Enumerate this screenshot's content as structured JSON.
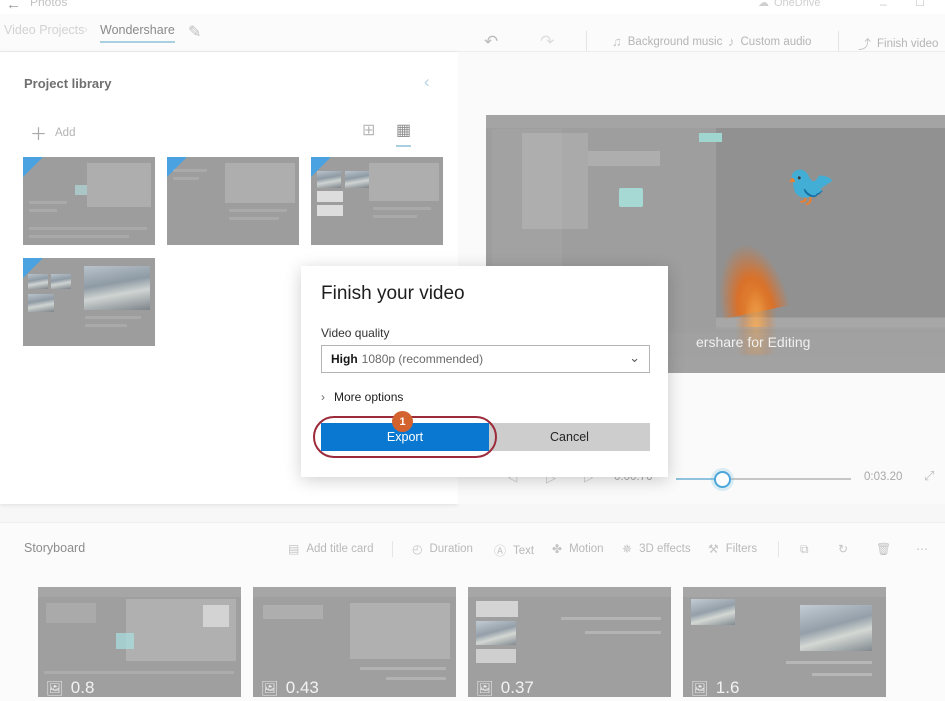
{
  "titlebar": {
    "back_icon": "back-arrow-icon",
    "app_name": "Photos",
    "onedrive_label": "OneDrive",
    "onedrive_icon": "cloud-icon",
    "minimize_glyph": "–",
    "maximize_glyph": "☐"
  },
  "breadcrumb": {
    "parent": "Video Projects",
    "separator": "›",
    "current": "Wondershare",
    "edit_icon": "pencil-icon"
  },
  "toolbar": {
    "undo_icon": "undo-arrow-icon",
    "undo_glyph": "↶",
    "redo_icon": "redo-arrow-icon",
    "redo_glyph": "↷",
    "background_music": "Background music",
    "background_music_icon": "music-note-icon",
    "background_music_glyph": "♫",
    "custom_audio": "Custom audio",
    "custom_audio_icon": "person-audio-icon",
    "custom_audio_glyph": "♪",
    "finish_video": "Finish video",
    "finish_video_icon": "share-export-icon",
    "finish_video_glyph": "⤴"
  },
  "library": {
    "title": "Project library",
    "collapse_icon": "chevron-left-icon",
    "collapse_glyph": "‹",
    "add_label": "Add",
    "add_glyph": "＋",
    "view_list_icon": "grid-view-small-icon",
    "view_list_glyph": "⊞",
    "view_grid_icon": "grid-view-large-icon",
    "view_grid_glyph": "▦",
    "items": [
      {
        "name": "library-thumbnail-1"
      },
      {
        "name": "library-thumbnail-2"
      },
      {
        "name": "library-thumbnail-3"
      },
      {
        "name": "library-thumbnail-4"
      }
    ]
  },
  "preview": {
    "caption": "ershare for Editing",
    "playback": {
      "previous_icon": "previous-frame-icon",
      "previous_glyph": "◁",
      "play_icon": "play-icon",
      "play_glyph": "▷",
      "next_icon": "next-frame-icon",
      "next_glyph": "▷",
      "current_time": "0:00.76",
      "total_time": "0:03.20",
      "fullscreen_icon": "expand-diagonal-icon",
      "fullscreen_glyph": "⤢"
    }
  },
  "storyboard": {
    "title": "Storyboard",
    "tools": [
      {
        "label": "Add title card",
        "icon": "title-card-icon",
        "glyph": "▤"
      },
      {
        "label": "Duration",
        "icon": "clock-icon",
        "glyph": "◴"
      },
      {
        "label": "Text",
        "icon": "text-icon",
        "glyph": "Ⓐ"
      },
      {
        "label": "Motion",
        "icon": "motion-icon",
        "glyph": "✤"
      },
      {
        "label": "3D effects",
        "icon": "three-d-effects-icon",
        "glyph": "✵"
      },
      {
        "label": "Filters",
        "icon": "filters-icon",
        "glyph": "⚒"
      }
    ],
    "actions": [
      {
        "name": "crop-button",
        "icon": "crop-icon",
        "glyph": "⧉"
      },
      {
        "name": "rotate-button",
        "icon": "rotate-icon",
        "glyph": "↻"
      },
      {
        "name": "delete-button",
        "icon": "trash-icon",
        "glyph": "Ὕ1"
      },
      {
        "name": "more-button",
        "icon": "ellipsis-icon",
        "glyph": "⋯"
      }
    ],
    "clips": [
      {
        "duration": "0.8",
        "icon": "image-icon"
      },
      {
        "duration": "0.43",
        "icon": "image-icon"
      },
      {
        "duration": "0.37",
        "icon": "image-icon"
      },
      {
        "duration": "1.6",
        "icon": "image-icon"
      }
    ]
  },
  "dialog": {
    "title": "Finish your video",
    "quality_label": "Video quality",
    "quality_value_strong": "High",
    "quality_value_rest": "1080p (recommended)",
    "caret_icon": "chevron-down-icon",
    "caret_glyph": "⌄",
    "more_options": "More options",
    "more_chevron_icon": "chevron-right-icon",
    "more_chevron_glyph": "›",
    "export_label": "Export",
    "cancel_label": "Cancel",
    "step_badge": "1"
  },
  "colors": {
    "accent_blue": "#0a78d1",
    "badge_orange": "#d4622e",
    "highlight_red": "#9c2a3a",
    "underline_blue": "#a9cfe0",
    "cancel_gray": "#cdcdcd"
  }
}
